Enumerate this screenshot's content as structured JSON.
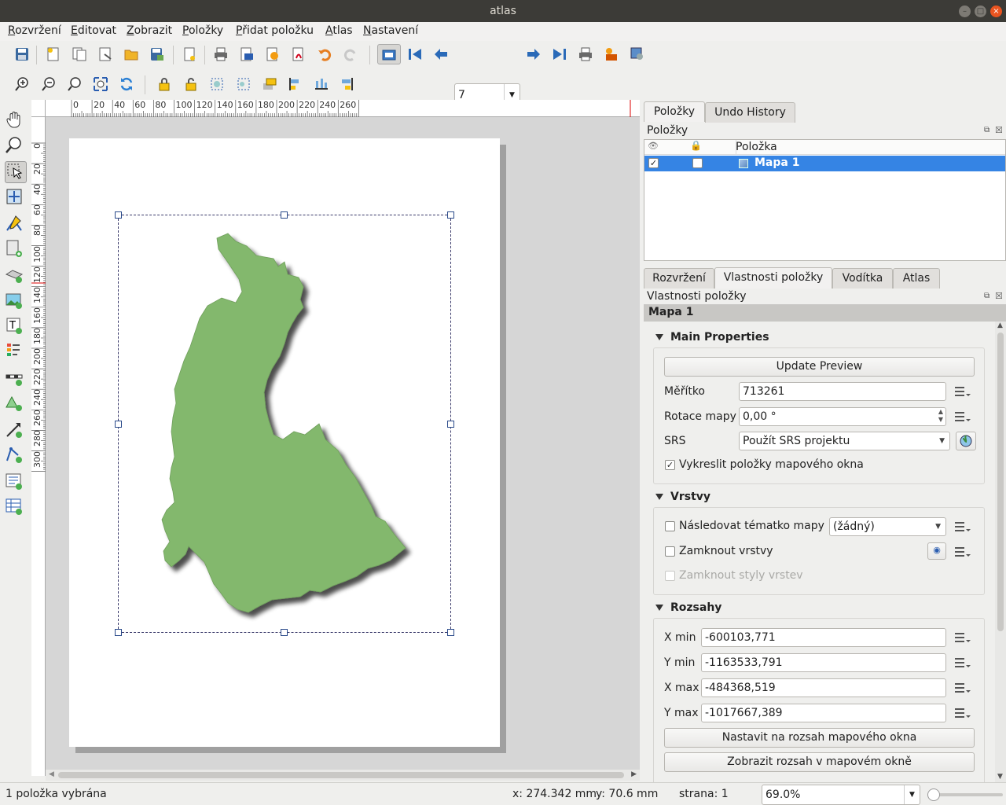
{
  "window": {
    "title": "atlas"
  },
  "menubar": {
    "items": [
      "Rozvržení",
      "Editovat",
      "Zobrazit",
      "Položky",
      "Přidat položku",
      "Atlas",
      "Nastavení"
    ]
  },
  "toolbar": {
    "atlas_page_value": "7"
  },
  "rulers": {
    "top_labels": [
      "0",
      "20",
      "40",
      "60",
      "80",
      "100",
      "120",
      "140",
      "160",
      "180",
      "200",
      "220",
      "240",
      "260"
    ],
    "left_labels": [
      "0",
      "20",
      "40",
      "60",
      "80",
      "100",
      "120",
      "140",
      "160",
      "180",
      "200",
      "220",
      "240",
      "260",
      "280",
      "300"
    ]
  },
  "items_panel": {
    "tabs": [
      "Položky",
      "Undo History"
    ],
    "title": "Položky",
    "column_item": "Položka",
    "rows": [
      {
        "name": "Mapa 1",
        "visible": true,
        "locked": false
      }
    ]
  },
  "props_panel": {
    "tabs": [
      "Rozvržení",
      "Vlastnosti položky",
      "Vodítka",
      "Atlas"
    ],
    "title": "Vlastnosti položky",
    "item_name": "Mapa 1",
    "main": {
      "header": "Main Properties",
      "update_preview": "Update Preview",
      "scale_label": "Měřítko",
      "scale_value": "713261",
      "rotation_label": "Rotace mapy",
      "rotation_value": "0,00 °",
      "srs_label": "SRS",
      "srs_value": "Použít SRS projektu",
      "draw_items_label": "Vykreslit položky mapového okna",
      "draw_items_checked": true
    },
    "layers": {
      "header": "Vrstvy",
      "follow_theme_label": "Následovat tématko mapy",
      "follow_theme_value": "(žádný)",
      "lock_layers_label": "Zamknout vrstvy",
      "lock_styles_label": "Zamknout styly vrstev"
    },
    "extents": {
      "header": "Rozsahy",
      "xmin_label": "X min",
      "xmin_value": "-600103,771",
      "ymin_label": "Y min",
      "ymin_value": "-1163533,791",
      "xmax_label": "X max",
      "xmax_value": "-484368,519",
      "ymax_label": "Y max",
      "ymax_value": "-1017667,389",
      "set_to_canvas": "Nastavit na rozsah mapového okna",
      "show_in_canvas": "Zobrazit rozsah v mapovém okně"
    }
  },
  "status": {
    "selection": "1 položka vybrána",
    "x_coord": "x: 274.342 mm",
    "y_coord": "y: 70.6 mm",
    "page": "strana: 1",
    "zoom": "69.0%"
  },
  "colors": {
    "map_fill": "#83b86d",
    "selection": "#3584e4",
    "titlebar": "#3c3b37"
  }
}
